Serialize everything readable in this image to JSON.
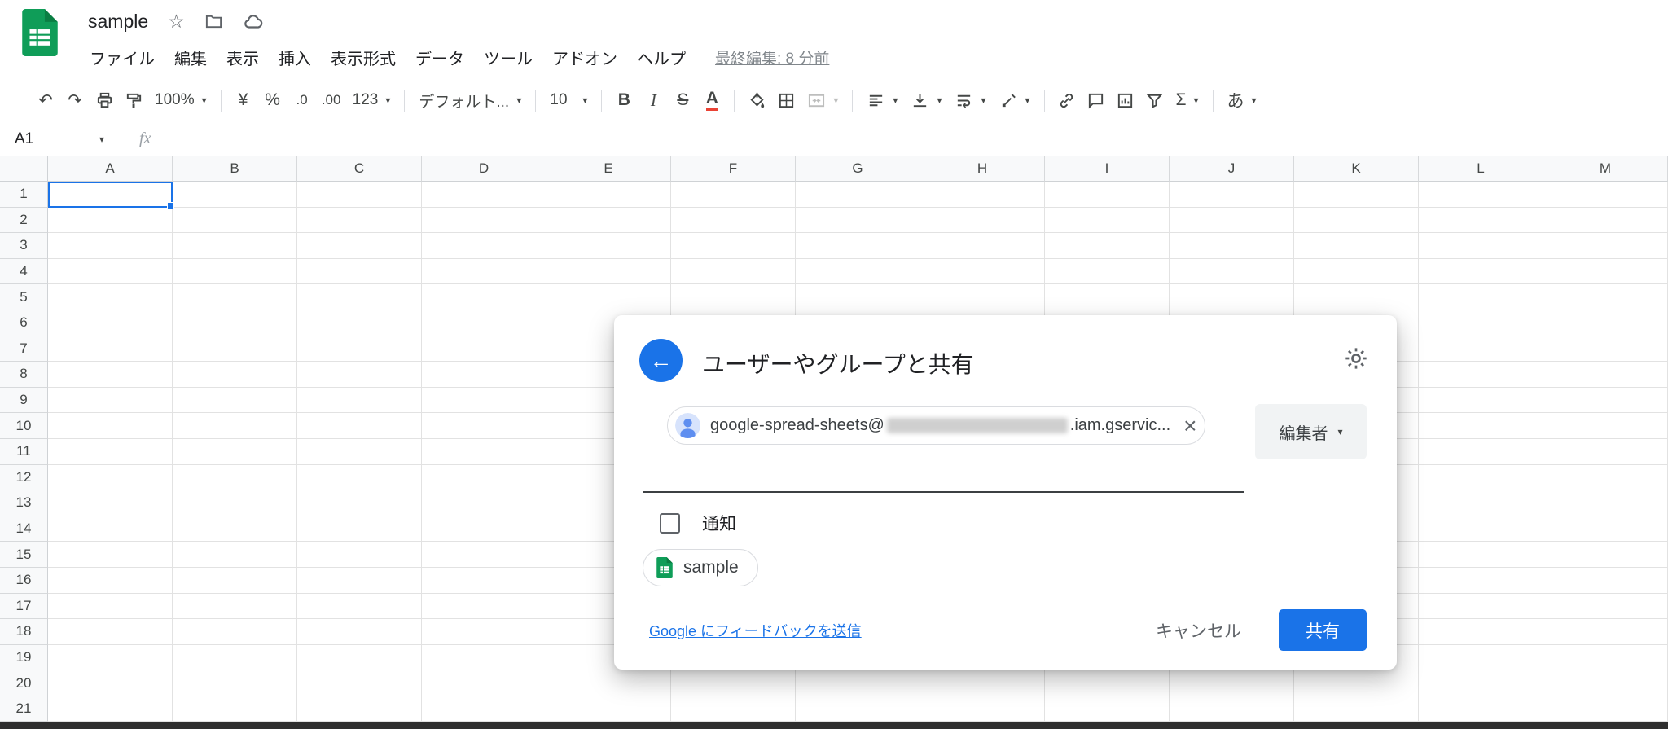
{
  "colors": {
    "accent": "#1a73e8",
    "sheets_green": "#0f9d58",
    "text_color_indicator": "#ea4335",
    "toolbar_icon": "#444746",
    "text_secondary": "#5f6368"
  },
  "icons": {
    "undo": "↶",
    "redo": "↷",
    "star": "☆",
    "chevron_down": "▾",
    "close": "×",
    "back_arrow": "←"
  },
  "header": {
    "doc_title": "sample",
    "menu_items": [
      "ファイル",
      "編集",
      "表示",
      "挿入",
      "表示形式",
      "データ",
      "ツール",
      "アドオン",
      "ヘルプ"
    ],
    "last_edited": "最終編集: 8 分前"
  },
  "toolbar": {
    "zoom_value": "100%",
    "format_currency": "¥",
    "format_percent": "%",
    "decrease_decimal": ".0",
    "increase_decimal": ".00",
    "more_formats": "123",
    "font_name": "デフォルト...",
    "font_size": "10",
    "bold": "B",
    "italic": "I",
    "strikethrough": "S",
    "text_color": "A",
    "functions": "Σ",
    "input_tools": "あ"
  },
  "formula_bar": {
    "cell_reference": "A1",
    "fx_label": "fx"
  },
  "grid": {
    "column_headers": [
      "A",
      "B",
      "C",
      "D",
      "E",
      "F",
      "G",
      "H",
      "I",
      "J",
      "K",
      "L",
      "M"
    ],
    "row_count": 21,
    "selected_cell": "A1"
  },
  "share_dialog": {
    "title": "ユーザーやグループと共有",
    "recipient_chip": {
      "email_prefix": "google-spread-sheets@",
      "email_suffix": ".iam.gservic..."
    },
    "role_selector": "編集者",
    "notify_label": "通知",
    "file_chip_label": "sample",
    "feedback_link": "Google にフィードバックを送信",
    "cancel_label": "キャンセル",
    "share_label": "共有"
  }
}
